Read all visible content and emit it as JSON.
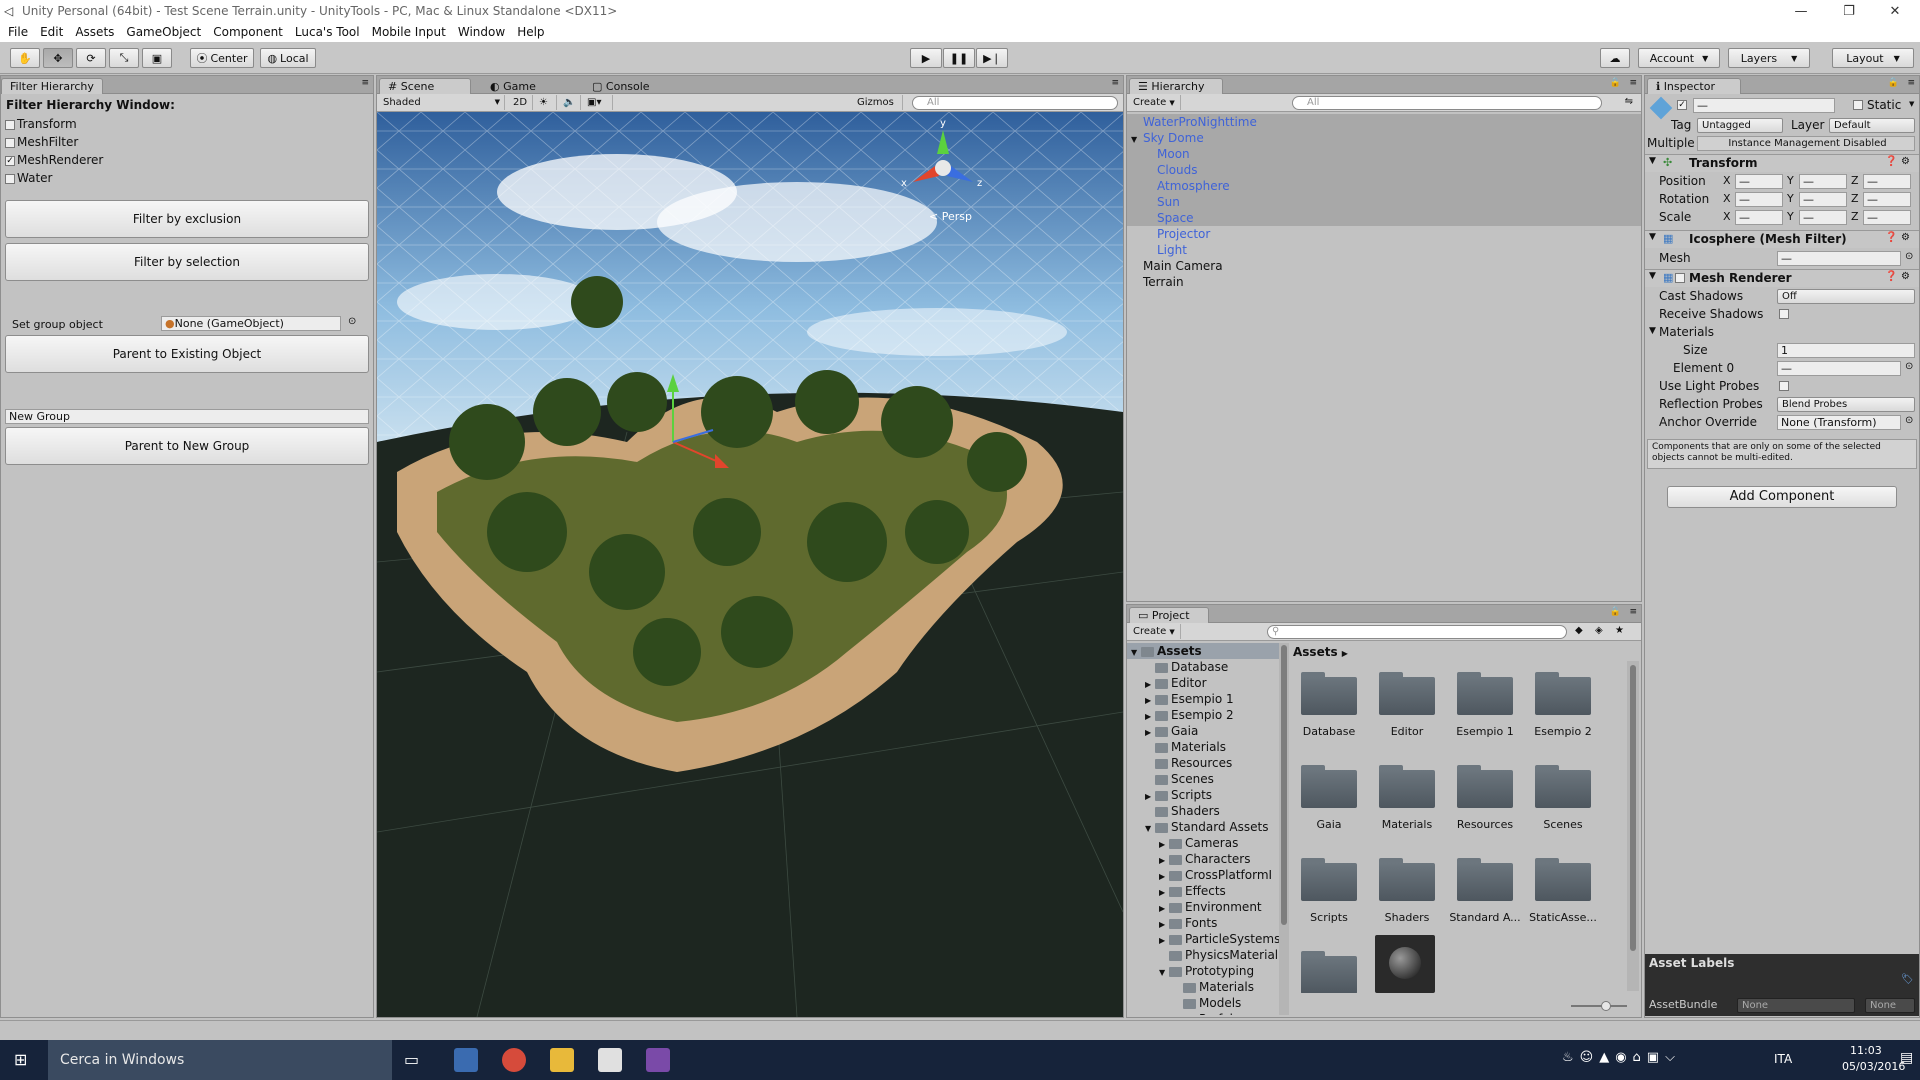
{
  "window": {
    "title": "Unity Personal (64bit) - Test Scene Terrain.unity - UnityTools - PC, Mac & Linux Standalone <DX11>"
  },
  "menu": [
    "File",
    "Edit",
    "Assets",
    "GameObject",
    "Component",
    "Luca's Tool",
    "Mobile Input",
    "Window",
    "Help"
  ],
  "toolbar": {
    "pivot": "Center",
    "space": "Local",
    "account": "Account",
    "layers": "Layers",
    "layout": "Layout"
  },
  "filter": {
    "tab": "Filter Hierarchy",
    "heading": "Filter Hierarchy Window:",
    "checks": [
      {
        "label": "Transform",
        "checked": false
      },
      {
        "label": "MeshFilter",
        "checked": false
      },
      {
        "label": "MeshRenderer",
        "checked": true
      },
      {
        "label": "Water",
        "checked": false
      }
    ],
    "exclusion_btn": "Filter by exclusion",
    "selection_btn": "Filter by selection",
    "group_label": "Set group object",
    "group_value": "None (GameObject)",
    "parent_existing_btn": "Parent to Existing Object",
    "new_group_value": "New Group",
    "parent_new_btn": "Parent to New Group"
  },
  "scene": {
    "tabs": [
      "Scene",
      "Game",
      "Console"
    ],
    "shading": "Shaded",
    "mode2d": "2D",
    "gizmos": "Gizmos",
    "search_placeholder": "All",
    "persp": "Persp",
    "axes": [
      "y",
      "x",
      "z"
    ]
  },
  "hierarchy": {
    "tab": "Hierarchy",
    "create": "Create",
    "search_placeholder": "All",
    "items": [
      {
        "label": "WaterProNighttime",
        "indent": 0,
        "selected": true,
        "blue": true,
        "arrow": ""
      },
      {
        "label": "Sky Dome",
        "indent": 0,
        "selected": true,
        "blue": true,
        "arrow": "▼"
      },
      {
        "label": "Moon",
        "indent": 1,
        "selected": true,
        "blue": true,
        "arrow": ""
      },
      {
        "label": "Clouds",
        "indent": 1,
        "selected": true,
        "blue": true,
        "arrow": ""
      },
      {
        "label": "Atmosphere",
        "indent": 1,
        "selected": true,
        "blue": true,
        "arrow": ""
      },
      {
        "label": "Sun",
        "indent": 1,
        "selected": true,
        "blue": true,
        "arrow": ""
      },
      {
        "label": "Space",
        "indent": 1,
        "selected": true,
        "blue": true,
        "arrow": ""
      },
      {
        "label": "Projector",
        "indent": 1,
        "selected": false,
        "blue": true,
        "arrow": ""
      },
      {
        "label": "Light",
        "indent": 1,
        "selected": false,
        "blue": true,
        "arrow": ""
      },
      {
        "label": "Main Camera",
        "indent": 0,
        "selected": false,
        "blue": false,
        "arrow": ""
      },
      {
        "label": "Terrain",
        "indent": 0,
        "selected": false,
        "blue": false,
        "arrow": ""
      }
    ]
  },
  "inspector": {
    "tab": "Inspector",
    "name_value": "—",
    "static_label": "Static",
    "tag_label": "Tag",
    "tag_value": "Untagged",
    "layer_label": "Layer",
    "layer_value": "Default",
    "multiple_label": "Multiple",
    "instance_value": "Instance Management Disabled",
    "transform": {
      "title": "Transform",
      "rows": [
        "Position",
        "Rotation",
        "Scale"
      ],
      "axes": [
        "X",
        "Y",
        "Z"
      ],
      "value": "—"
    },
    "mesh_filter": {
      "title": "Icosphere (Mesh Filter)",
      "mesh_label": "Mesh",
      "mesh_value": "—"
    },
    "mesh_renderer": {
      "title": "Mesh Renderer",
      "cast_shadows_label": "Cast Shadows",
      "cast_shadows_value": "Off",
      "receive_shadows_label": "Receive Shadows",
      "materials_label": "Materials",
      "size_label": "Size",
      "size_value": "1",
      "element0_label": "Element 0",
      "element0_value": "—",
      "light_probes_label": "Use Light Probes",
      "reflection_label": "Reflection Probes",
      "reflection_value": "Blend Probes",
      "anchor_label": "Anchor Override",
      "anchor_value": "None (Transform)"
    },
    "note": "Components that are only on some of the selected objects cannot be multi-edited.",
    "add_component": "Add Component",
    "asset_labels": "Asset Labels",
    "asset_bundle_label": "AssetBundle",
    "asset_bundle_value": "None",
    "asset_bundle_variant": "None"
  },
  "project": {
    "tab": "Project",
    "create": "Create",
    "breadcrumb": "Assets",
    "tree": [
      {
        "label": "Assets",
        "indent": 0,
        "arrow": "▼",
        "selected": true,
        "bold": true
      },
      {
        "label": "Database",
        "indent": 1,
        "arrow": "",
        "selected": false,
        "bold": false
      },
      {
        "label": "Editor",
        "indent": 1,
        "arrow": "▶",
        "selected": false,
        "bold": false
      },
      {
        "label": "Esempio 1",
        "indent": 1,
        "arrow": "▶",
        "selected": false,
        "bold": false
      },
      {
        "label": "Esempio 2",
        "indent": 1,
        "arrow": "▶",
        "selected": false,
        "bold": false
      },
      {
        "label": "Gaia",
        "indent": 1,
        "arrow": "▶",
        "selected": false,
        "bold": false
      },
      {
        "label": "Materials",
        "indent": 1,
        "arrow": "",
        "selected": false,
        "bold": false
      },
      {
        "label": "Resources",
        "indent": 1,
        "arrow": "",
        "selected": false,
        "bold": false
      },
      {
        "label": "Scenes",
        "indent": 1,
        "arrow": "",
        "selected": false,
        "bold": false
      },
      {
        "label": "Scripts",
        "indent": 1,
        "arrow": "▶",
        "selected": false,
        "bold": false
      },
      {
        "label": "Shaders",
        "indent": 1,
        "arrow": "",
        "selected": false,
        "bold": false
      },
      {
        "label": "Standard Assets",
        "indent": 1,
        "arrow": "▼",
        "selected": false,
        "bold": false
      },
      {
        "label": "Cameras",
        "indent": 2,
        "arrow": "▶",
        "selected": false,
        "bold": false
      },
      {
        "label": "Characters",
        "indent": 2,
        "arrow": "▶",
        "selected": false,
        "bold": false
      },
      {
        "label": "CrossPlatformI",
        "indent": 2,
        "arrow": "▶",
        "selected": false,
        "bold": false
      },
      {
        "label": "Effects",
        "indent": 2,
        "arrow": "▶",
        "selected": false,
        "bold": false
      },
      {
        "label": "Environment",
        "indent": 2,
        "arrow": "▶",
        "selected": false,
        "bold": false
      },
      {
        "label": "Fonts",
        "indent": 2,
        "arrow": "▶",
        "selected": false,
        "bold": false
      },
      {
        "label": "ParticleSystems",
        "indent": 2,
        "arrow": "▶",
        "selected": false,
        "bold": false
      },
      {
        "label": "PhysicsMaterial",
        "indent": 2,
        "arrow": "",
        "selected": false,
        "bold": false
      },
      {
        "label": "Prototyping",
        "indent": 2,
        "arrow": "▼",
        "selected": false,
        "bold": false
      },
      {
        "label": "Materials",
        "indent": 3,
        "arrow": "",
        "selected": false,
        "bold": false
      },
      {
        "label": "Models",
        "indent": 3,
        "arrow": "",
        "selected": false,
        "bold": false
      },
      {
        "label": "Prefabs",
        "indent": 3,
        "arrow": "",
        "selected": false,
        "bold": false
      }
    ],
    "grid": [
      "Database",
      "Editor",
      "Esempio 1",
      "Esempio 2",
      "Gaia",
      "Materials",
      "Resources",
      "Scenes",
      "Scripts",
      "Shaders",
      "Standard A...",
      "StaticAsse..."
    ]
  },
  "taskbar": {
    "search": "Cerca in Windows",
    "lang": "ITA",
    "time": "11:03",
    "date": "05/03/2016"
  }
}
